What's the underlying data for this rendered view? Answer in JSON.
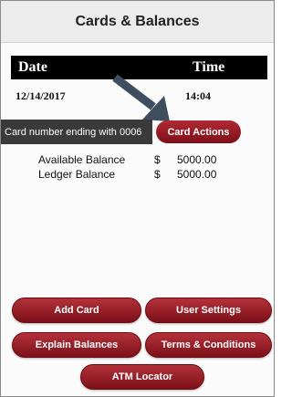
{
  "header": {
    "title": "Cards & Balances"
  },
  "datetime": {
    "date_label": "Date",
    "time_label": "Time",
    "date_value": "12/14/2017",
    "time_value": "14:04"
  },
  "card": {
    "tooltip_text": "Card number ending with 0006",
    "actions_label": "Card Actions"
  },
  "balances": [
    {
      "label": "Available Balance",
      "currency": "$",
      "amount": "5000.00"
    },
    {
      "label": "Ledger Balance",
      "currency": "$",
      "amount": "5000.00"
    }
  ],
  "buttons": {
    "add_card": "Add Card",
    "user_settings": "User Settings",
    "explain_balances": "Explain Balances",
    "terms": "Terms & Conditions",
    "atm_locator": "ATM Locator"
  },
  "colors": {
    "accent": "#8e1b22",
    "bar": "#000000",
    "tooltip": "#3a3a3a"
  },
  "icons": {
    "pointer": "arrow-pointer-icon"
  }
}
